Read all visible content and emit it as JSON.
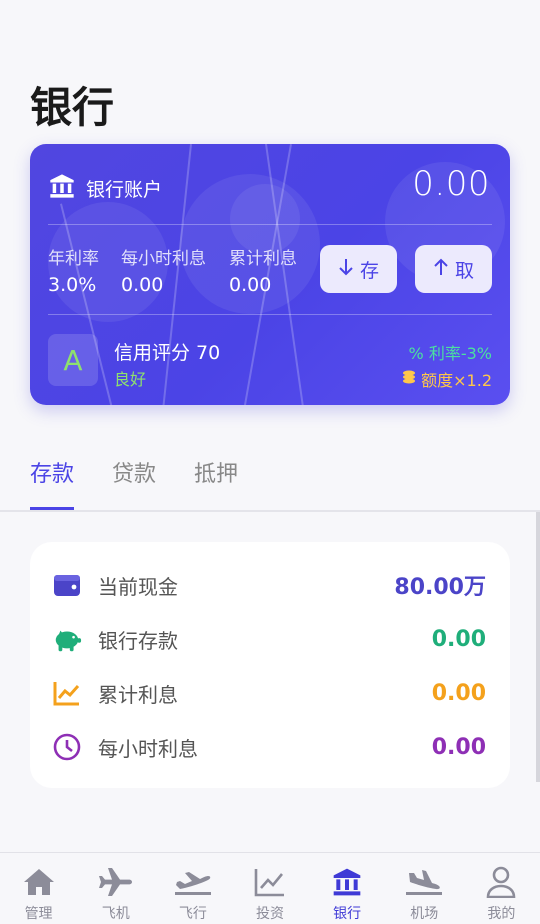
{
  "page": {
    "title": "银行"
  },
  "card": {
    "label": "银行账户",
    "balance": "0.00",
    "stats": [
      {
        "key": "年利率",
        "value": "3.0%"
      },
      {
        "key": "每小时利息",
        "value": "0.00"
      },
      {
        "key": "累计利息",
        "value": "0.00"
      }
    ],
    "deposit_label": "存",
    "withdraw_label": "取",
    "credit": {
      "grade": "A",
      "title": "信用评分 70",
      "level": "良好",
      "perk_rate": "利率-3%",
      "perk_limit": "额度×1.2"
    }
  },
  "tabs": [
    {
      "label": "存款",
      "active": true
    },
    {
      "label": "贷款",
      "active": false
    },
    {
      "label": "抵押",
      "active": false
    }
  ],
  "summary": [
    {
      "label": "当前现金",
      "value": "80.00万",
      "color": "#4b44c8",
      "icon": "wallet-icon"
    },
    {
      "label": "银行存款",
      "value": "0.00",
      "color": "#1fae7a",
      "icon": "piggy-bank-icon"
    },
    {
      "label": "累计利息",
      "value": "0.00",
      "color": "#f4a11c",
      "icon": "trend-chart-icon"
    },
    {
      "label": "每小时利息",
      "value": "0.00",
      "color": "#8e2fb5",
      "icon": "clock-icon"
    }
  ],
  "nav": [
    {
      "label": "管理",
      "icon": "home-icon"
    },
    {
      "label": "飞机",
      "icon": "airplane-icon"
    },
    {
      "label": "飞行",
      "icon": "takeoff-icon"
    },
    {
      "label": "投资",
      "icon": "chart-icon"
    },
    {
      "label": "银行",
      "icon": "bank-icon"
    },
    {
      "label": "机场",
      "icon": "landing-icon"
    },
    {
      "label": "我的",
      "icon": "person-icon"
    }
  ],
  "colors": {
    "accent": "#4b44e6",
    "card_bg": "#4b44e6"
  }
}
